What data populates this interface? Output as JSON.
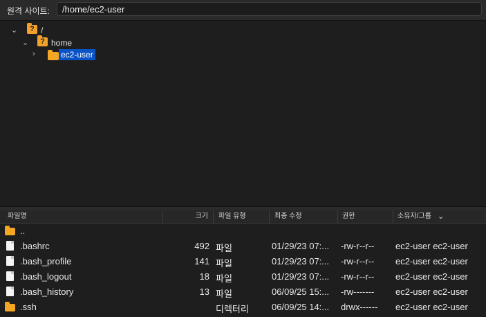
{
  "pathbar": {
    "label": "원격 사이트:",
    "path": "/home/ec2-user"
  },
  "tree": {
    "root": "/",
    "home": "home",
    "selected": "ec2-user"
  },
  "columns": {
    "name": "파일명",
    "size": "크기",
    "type": "파일 유형",
    "modified": "최종 수정",
    "permissions": "권한",
    "owner": "소유자/그룹"
  },
  "files": [
    {
      "name": "..",
      "size": "",
      "type": "",
      "modified": "",
      "perm": "",
      "owner": "",
      "icon": "folder-icon"
    },
    {
      "name": ".bashrc",
      "size": "492",
      "type": "파일",
      "modified": "01/29/23 07:...",
      "perm": "-rw-r--r--",
      "owner": "ec2-user ec2-user",
      "icon": "file-icon"
    },
    {
      "name": ".bash_profile",
      "size": "141",
      "type": "파일",
      "modified": "01/29/23 07:...",
      "perm": "-rw-r--r--",
      "owner": "ec2-user ec2-user",
      "icon": "file-icon"
    },
    {
      "name": ".bash_logout",
      "size": "18",
      "type": "파일",
      "modified": "01/29/23 07:...",
      "perm": "-rw-r--r--",
      "owner": "ec2-user ec2-user",
      "icon": "file-icon"
    },
    {
      "name": ".bash_history",
      "size": "13",
      "type": "파일",
      "modified": "06/09/25 15:...",
      "perm": "-rw-------",
      "owner": "ec2-user ec2-user",
      "icon": "file-icon"
    },
    {
      "name": ".ssh",
      "size": "",
      "type": "디렉터리",
      "modified": "06/09/25 14:...",
      "perm": "drwx------",
      "owner": "ec2-user ec2-user",
      "icon": "folder-icon"
    }
  ],
  "colors": {
    "selection": "#0a53c7",
    "folder": "#f5a623",
    "background": "#1e1e1e"
  }
}
